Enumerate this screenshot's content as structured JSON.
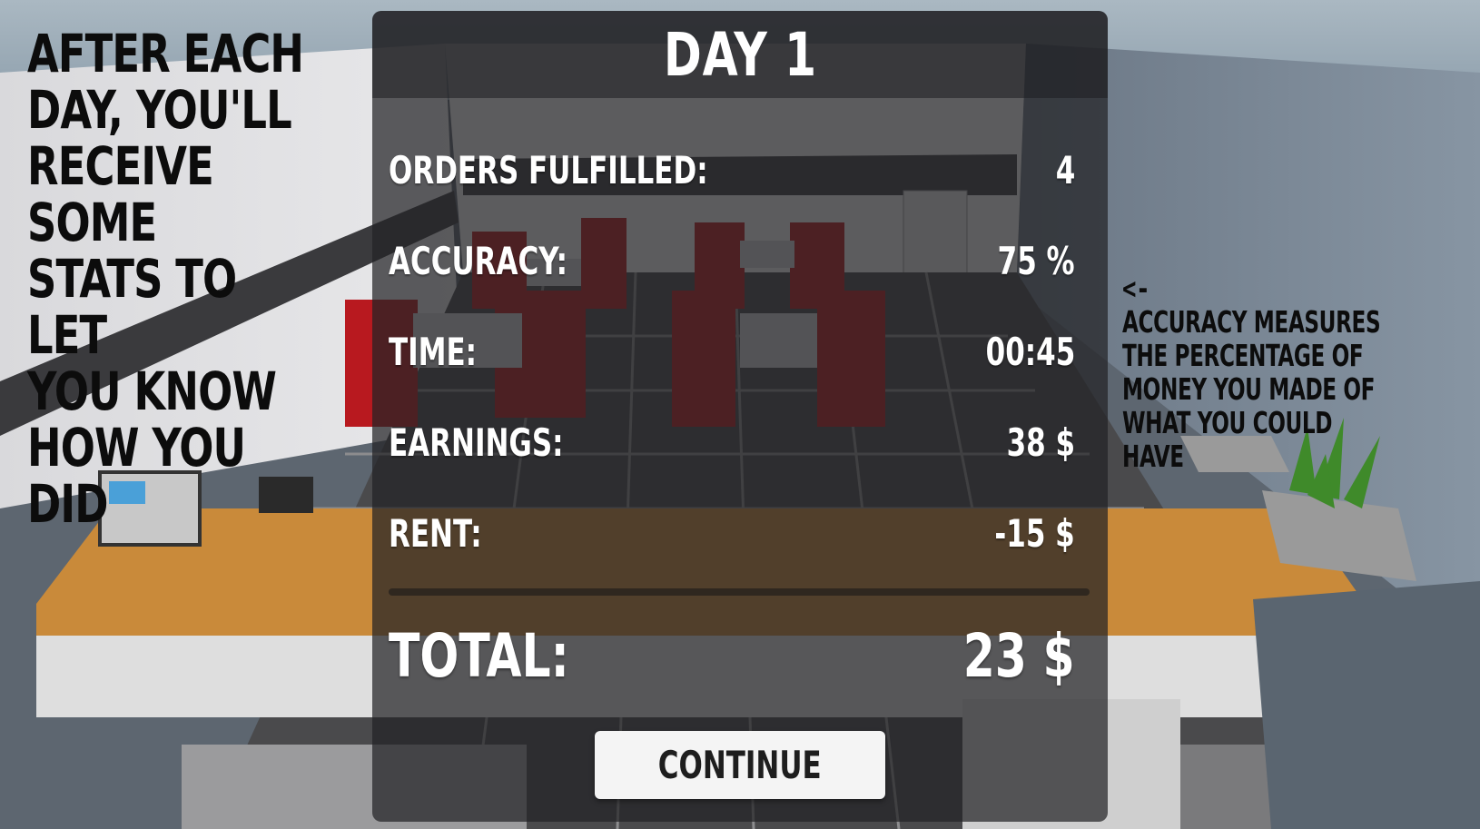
{
  "tutorial": {
    "left_text": "AFTER EACH\nDAY, YOU'LL\nRECEIVE SOME\nSTATS TO LET\nYOU KNOW\nHOW YOU DID",
    "right_arrow": "<-",
    "right_text": "ACCURACY MEASURES\nTHE PERCENTAGE OF\nMONEY YOU MADE OF\nWHAT YOU COULD HAVE"
  },
  "summary": {
    "title": "DAY 1",
    "stats": [
      {
        "label": "ORDERS FULFILLED:",
        "value": "4"
      },
      {
        "label": "ACCURACY:",
        "value": "75 %"
      },
      {
        "label": "TIME:",
        "value": "00:45"
      },
      {
        "label": "EARNINGS:",
        "value": "38 $"
      },
      {
        "label": "RENT:",
        "value": "-15 $"
      }
    ],
    "total_label": "TOTAL:",
    "total_value": "23 $",
    "continue_label": "CONTINUE"
  },
  "colors": {
    "panel": "#232326",
    "booth_red": "#b8191f",
    "counter_wood": "#c98a3a",
    "button": "#f4f4f4"
  }
}
